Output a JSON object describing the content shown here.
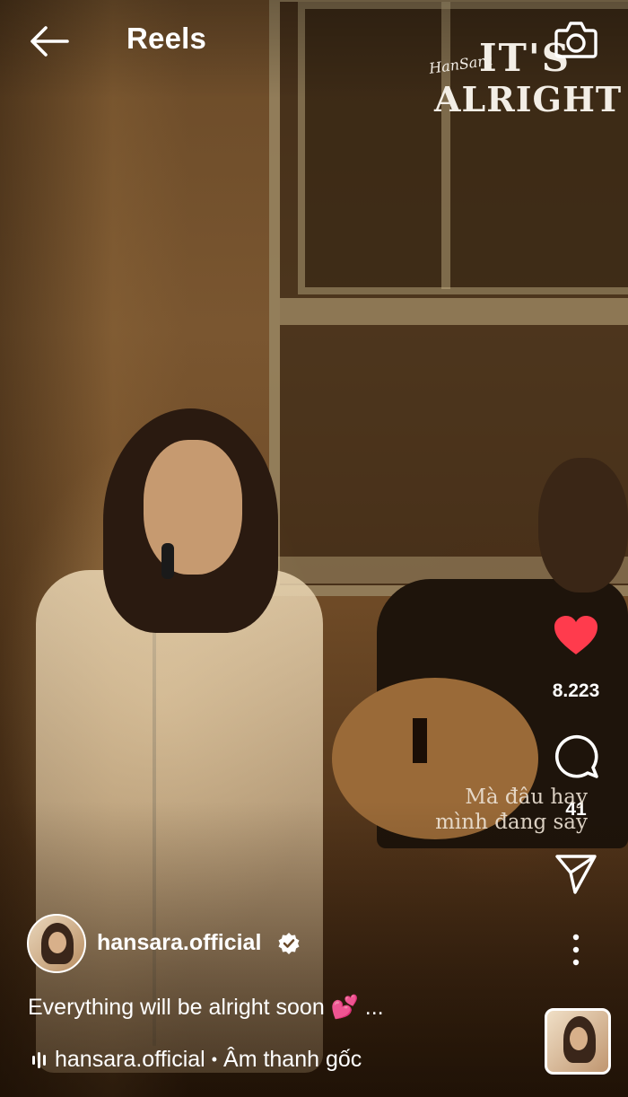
{
  "header": {
    "title": "Reels",
    "back_icon": "arrow-left-icon",
    "camera_icon": "camera-icon"
  },
  "video": {
    "overlay_logo": {
      "script": "HanSara",
      "line1": "IT'S",
      "line2": "ALRIGHT"
    },
    "subtitle_line1": "Mà đâu hay",
    "subtitle_line2": "mình đang say"
  },
  "actions": {
    "like_count": "8.223",
    "liked_color": "#ff3b4d",
    "comment_count": "41",
    "share_icon": "send-icon",
    "more_icon": "more-vertical-icon"
  },
  "post": {
    "username": "hansara.official",
    "verified": true,
    "caption": "Everything will be alright soon 💕 ...",
    "audio_user": "hansara.official",
    "audio_separator": "•",
    "audio_label": "Âm thanh gốc"
  }
}
